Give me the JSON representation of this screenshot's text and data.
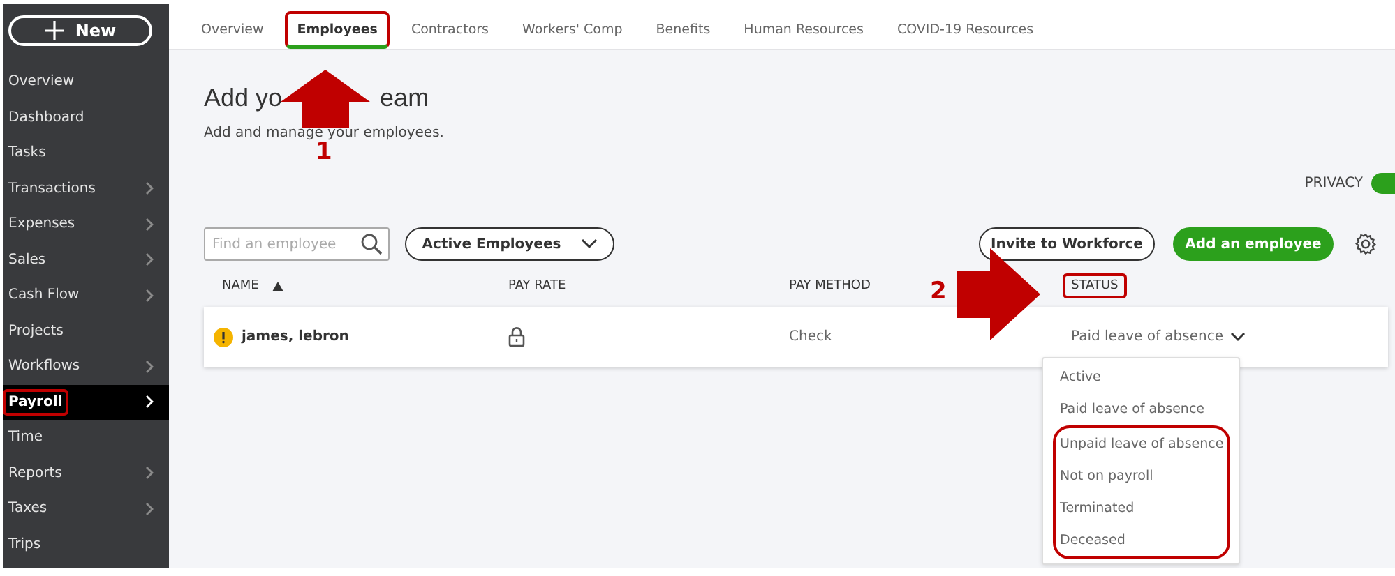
{
  "sidebar": {
    "new_button": {
      "label": "New"
    },
    "items": [
      {
        "label": "Overview",
        "expandable": false,
        "selected": false,
        "highlighted": false
      },
      {
        "label": "Dashboard",
        "expandable": false,
        "selected": false,
        "highlighted": false
      },
      {
        "label": "Tasks",
        "expandable": false,
        "selected": false,
        "highlighted": false
      },
      {
        "label": "Transactions",
        "expandable": true,
        "selected": false,
        "highlighted": false
      },
      {
        "label": "Expenses",
        "expandable": true,
        "selected": false,
        "highlighted": false
      },
      {
        "label": "Sales",
        "expandable": true,
        "selected": false,
        "highlighted": false
      },
      {
        "label": "Cash Flow",
        "expandable": true,
        "selected": false,
        "highlighted": false
      },
      {
        "label": "Projects",
        "expandable": false,
        "selected": false,
        "highlighted": false
      },
      {
        "label": "Workflows",
        "expandable": true,
        "selected": false,
        "highlighted": false
      },
      {
        "label": "Payroll",
        "expandable": true,
        "selected": true,
        "highlighted": true
      },
      {
        "label": "Time",
        "expandable": false,
        "selected": false,
        "highlighted": false
      },
      {
        "label": "Reports",
        "expandable": true,
        "selected": false,
        "highlighted": false
      },
      {
        "label": "Taxes",
        "expandable": true,
        "selected": false,
        "highlighted": false
      },
      {
        "label": "Trips",
        "expandable": false,
        "selected": false,
        "highlighted": false
      }
    ]
  },
  "tabs": [
    {
      "label": "Overview",
      "selected": false,
      "highlighted": false
    },
    {
      "label": "Employees",
      "selected": true,
      "highlighted": true
    },
    {
      "label": "Contractors",
      "selected": false,
      "highlighted": false
    },
    {
      "label": "Workers' Comp",
      "selected": false,
      "highlighted": false
    },
    {
      "label": "Benefits",
      "selected": false,
      "highlighted": false
    },
    {
      "label": "Human Resources",
      "selected": false,
      "highlighted": false
    },
    {
      "label": "COVID-19 Resources",
      "selected": false,
      "highlighted": false
    }
  ],
  "header": {
    "title_parts": [
      "Add yo",
      "eam"
    ],
    "subtitle": "Add and manage your employees."
  },
  "privacy": {
    "label": "PRIVACY",
    "on": true
  },
  "toolbar": {
    "search": {
      "placeholder": "Find an employee"
    },
    "filter": {
      "label": "Active Employees"
    },
    "invite_button": {
      "label": "Invite to Workforce"
    },
    "add_button": {
      "label": "Add an employee"
    }
  },
  "table": {
    "columns": [
      {
        "label": "NAME",
        "sorted": true,
        "highlighted": false
      },
      {
        "label": "PAY RATE",
        "sorted": false,
        "highlighted": false
      },
      {
        "label": "PAY METHOD",
        "sorted": false,
        "highlighted": false
      },
      {
        "label": "STATUS",
        "sorted": false,
        "highlighted": true
      }
    ],
    "rows": [
      {
        "warning": true,
        "name": "james, lebron",
        "pay_rate_locked": true,
        "pay_method": "Check",
        "status": "Paid leave of absence"
      }
    ]
  },
  "status_menu": {
    "expanded": true,
    "items": [
      {
        "label": "Active",
        "highlighted": false
      },
      {
        "label": "Paid leave of absence",
        "highlighted": false
      },
      {
        "label": "Unpaid leave of absence",
        "highlighted": true
      },
      {
        "label": "Not on payroll",
        "highlighted": true
      },
      {
        "label": "Terminated",
        "highlighted": true
      },
      {
        "label": "Deceased",
        "highlighted": true
      }
    ]
  },
  "annotations": [
    {
      "kind": "uparrow",
      "label": "1"
    },
    {
      "kind": "rightarrow",
      "label": "2"
    }
  ]
}
